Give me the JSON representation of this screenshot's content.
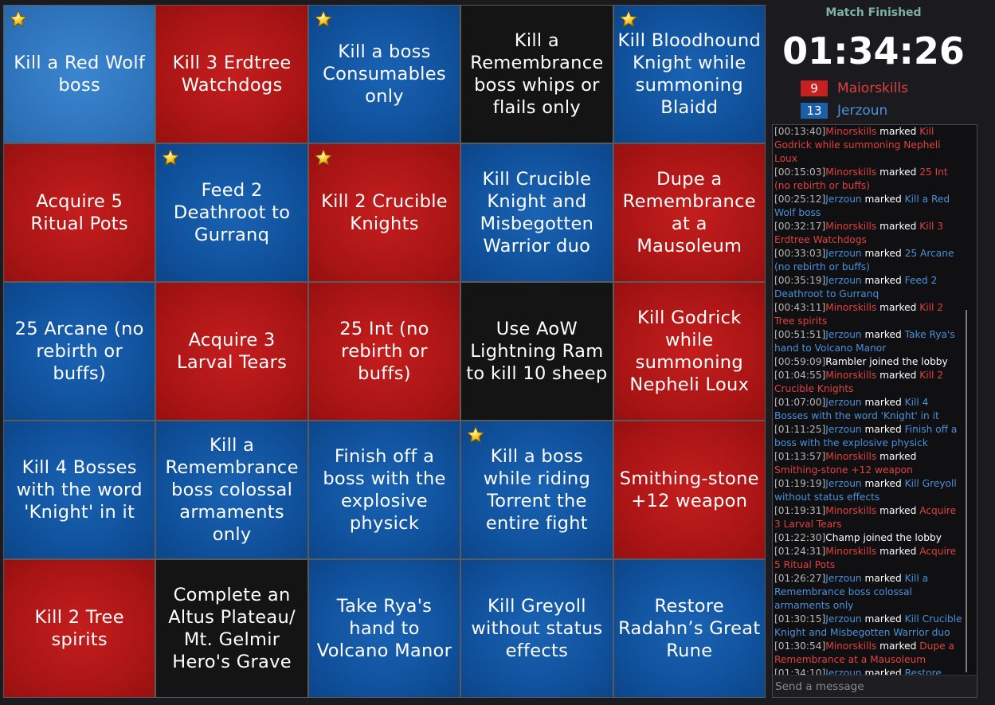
{
  "board": {
    "cells": [
      {
        "text": "Kill a Red Wolf boss",
        "color": "light",
        "star": true
      },
      {
        "text": "Kill 3 Erdtree Watchdogs",
        "color": "red",
        "star": false
      },
      {
        "text": "Kill a boss Consumables only",
        "color": "blue",
        "star": true
      },
      {
        "text": "Kill a Remembrance boss whips or flails only",
        "color": "black",
        "star": false
      },
      {
        "text": "Kill Bloodhound Knight while summoning Blaidd",
        "color": "blue",
        "star": true
      },
      {
        "text": "Acquire 5 Ritual Pots",
        "color": "red",
        "star": false
      },
      {
        "text": "Feed 2 Deathroot to Gurranq",
        "color": "blue",
        "star": true
      },
      {
        "text": "Kill 2 Crucible Knights",
        "color": "red",
        "star": true
      },
      {
        "text": "Kill Crucible Knight and Misbegotten Warrior duo",
        "color": "blue",
        "star": false
      },
      {
        "text": "Dupe a Remembrance at a Mausoleum",
        "color": "red",
        "star": false
      },
      {
        "text": "25 Arcane (no rebirth or buffs)",
        "color": "blue",
        "star": false
      },
      {
        "text": "Acquire 3 Larval Tears",
        "color": "red",
        "star": false
      },
      {
        "text": "25 Int (no rebirth or buffs)",
        "color": "red",
        "star": false
      },
      {
        "text": "Use AoW Lightning Ram to kill 10 sheep",
        "color": "black",
        "star": false
      },
      {
        "text": "Kill Godrick while summoning Nepheli Loux",
        "color": "red",
        "star": false
      },
      {
        "text": "Kill 4 Bosses with the word 'Knight' in it",
        "color": "blue",
        "star": false
      },
      {
        "text": "Kill a Remembrance boss colossal armaments only",
        "color": "blue",
        "star": false
      },
      {
        "text": "Finish off a boss with the explosive physick",
        "color": "blue",
        "star": false
      },
      {
        "text": "Kill a boss while riding Torrent the entire fight",
        "color": "blue",
        "star": true
      },
      {
        "text": "Smithing-stone +12 weapon",
        "color": "red",
        "star": false
      },
      {
        "text": "Kill 2 Tree spirits",
        "color": "red",
        "star": false
      },
      {
        "text": "Complete an Altus Plateau/ Mt. Gelmir Hero's Grave",
        "color": "black",
        "star": false
      },
      {
        "text": "Take Rya's hand to Volcano Manor",
        "color": "blue",
        "star": false
      },
      {
        "text": "Kill Greyoll without status effects",
        "color": "blue",
        "star": false
      },
      {
        "text": "Restore Radahn’s Great Rune",
        "color": "blue",
        "star": false
      }
    ]
  },
  "sidebar": {
    "status": "Match Finished",
    "timer": "01:34:26",
    "players": [
      {
        "score": "9",
        "name": "Maiorskills",
        "team": "red"
      },
      {
        "score": "13",
        "name": "Jerzoun",
        "team": "blue"
      }
    ],
    "chat": {
      "placeholder": "Send a message",
      "messages": [
        {
          "ts": "[00:13:40]",
          "user": "Minorskills",
          "team": "red",
          "action": "marked",
          "target": "Kill Godrick while summoning Nepheli Loux"
        },
        {
          "ts": "[00:15:03]",
          "user": "Minorskills",
          "team": "red",
          "action": "marked",
          "target": "25 Int (no rebirth or buffs)"
        },
        {
          "ts": "[00:25:12]",
          "user": "Jerzoun",
          "team": "blue",
          "action": "marked",
          "target": "Kill a Red Wolf boss"
        },
        {
          "ts": "[00:32:17]",
          "user": "Minorskills",
          "team": "red",
          "action": "marked",
          "target": "Kill 3 Erdtree Watchdogs"
        },
        {
          "ts": "[00:33:03]",
          "user": "Jerzoun",
          "team": "blue",
          "action": "marked",
          "target": "25 Arcane (no rebirth or buffs)"
        },
        {
          "ts": "[00:35:19]",
          "user": "Jerzoun",
          "team": "blue",
          "action": "marked",
          "target": "Feed 2 Deathroot to Gurranq"
        },
        {
          "ts": "[00:43:11]",
          "user": "Minorskills",
          "team": "red",
          "action": "marked",
          "target": "Kill 2 Tree spirits"
        },
        {
          "ts": "[00:51:51]",
          "user": "Jerzoun",
          "team": "blue",
          "action": "marked",
          "target": "Take Rya's hand to Volcano Manor"
        },
        {
          "ts": "[00:59:09]",
          "user": "Rambler",
          "team": "none",
          "action": "joined the lobby",
          "target": ""
        },
        {
          "ts": "[01:04:55]",
          "user": "Minorskills",
          "team": "red",
          "action": "marked",
          "target": "Kill 2 Crucible Knights"
        },
        {
          "ts": "[01:07:00]",
          "user": "Jerzoun",
          "team": "blue",
          "action": "marked",
          "target": "Kill 4 Bosses with the word 'Knight' in it"
        },
        {
          "ts": "[01:11:25]",
          "user": "Jerzoun",
          "team": "blue",
          "action": "marked",
          "target": "Finish off a boss with the explosive physick"
        },
        {
          "ts": "[01:13:57]",
          "user": "Minorskills",
          "team": "red",
          "action": "marked",
          "target": "Smithing-stone +12 weapon"
        },
        {
          "ts": "[01:19:19]",
          "user": "Jerzoun",
          "team": "blue",
          "action": "marked",
          "target": "Kill Greyoll without status effects"
        },
        {
          "ts": "[01:19:31]",
          "user": "Minorskills",
          "team": "red",
          "action": "marked",
          "target": "Acquire 3 Larval Tears"
        },
        {
          "ts": "[01:22:30]",
          "user": "Champ",
          "team": "none",
          "action": "joined the lobby",
          "target": ""
        },
        {
          "ts": "[01:24:31]",
          "user": "Minorskills",
          "team": "red",
          "action": "marked",
          "target": "Acquire 5 Ritual Pots"
        },
        {
          "ts": "[01:26:27]",
          "user": "Jerzoun",
          "team": "blue",
          "action": "marked",
          "target": "Kill a Remembrance boss colossal armaments only"
        },
        {
          "ts": "[01:30:15]",
          "user": "Jerzoun",
          "team": "blue",
          "action": "marked",
          "target": "Kill Crucible Knight and Misbegotten Warrior duo"
        },
        {
          "ts": "[01:30:54]",
          "user": "Minorskills",
          "team": "red",
          "action": "marked",
          "target": "Dupe a Remembrance at a Mausoleum"
        },
        {
          "ts": "[01:34:10]",
          "user": "Jerzoun",
          "team": "blue",
          "action": "marked",
          "target": "Restore Radahn's Great Rune"
        }
      ]
    }
  },
  "colors": {
    "red_team": "#e04040",
    "blue_team": "#4a90d9",
    "red_cell": "#a81414",
    "blue_cell": "#0f4f99",
    "black_cell": "#141414",
    "light_cell": "#2d73bb",
    "red_score": "#c62020",
    "blue_score": "#1a5fa8"
  },
  "icons": {
    "goal_star": "star-icon"
  }
}
